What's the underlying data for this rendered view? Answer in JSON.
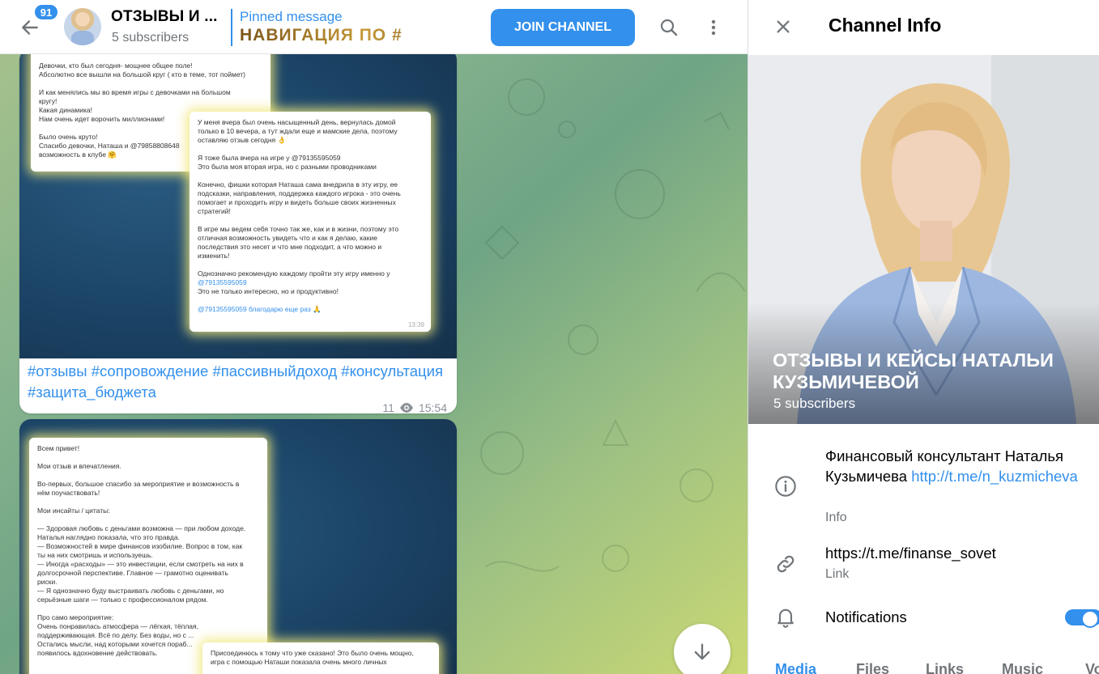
{
  "header": {
    "unread_count": "91",
    "channel_title": "ОТЗЫВЫ И ...",
    "subscribers": "5 subscribers",
    "pinned_label": "Pinned message",
    "pinned_text": "НАВИГАЦИЯ ПО #",
    "join_label": "JOIN CHANNEL",
    "icons": [
      "back-arrow-icon",
      "search-icon",
      "more-vertical-icon"
    ]
  },
  "messages": [
    {
      "caption": "#отзывы #сопровождение #пассивныйдоход #консультация #защита_бюджета",
      "views": "11",
      "time": "15:54",
      "card1_lines": [
        "Девочки, кто был сегодня- мощнее общее поле!",
        "Абсолютно все вышли на большой круг ( кто в теме, тот поймет)",
        "",
        "И как менялись мы во время игры с девочками на большом",
        "кругу!",
        "Какая динамика!",
        "Нам очень идет ворочить миллионами!",
        "",
        "Было очень круто!",
        "Спасибо девочки, Наташа и @79858808648",
        "возможность в клубе 🤗"
      ],
      "card2_lines": [
        "У меня вчера был очень насыщенный день, вернулась домой",
        "только в 10 вечера, а тут ждали еще и мамские дела, поэтому",
        "оставляю отзыв сегодня 👌",
        "",
        "Я тоже была вчера на игре у @79135595059",
        "Это была моя вторая игра, но с разными проводниками",
        "",
        "Конечно, фишки которая Наташа сама внедрила в эту игру, ее",
        "подсказки, направления, поддержка каждого игрока - это очень",
        "помогает и проходить игру и видеть больше своих жизненных",
        "стратегий!",
        "",
        "В игре мы ведем себя точно так же, как и в жизни, поэтому это",
        "отличная возможность увидеть что и как я делаю, какие",
        "последствия это несет и что мне подходит, а что можно и",
        "изменить!",
        "",
        "Однозначно рекомендую каждому пройти эту игру именно у",
        "@79135595059",
        "Это не только интересно, но и продуктивно!",
        "",
        "@79135595059 благодарю еще раз 🙏"
      ],
      "card2_time": "13:39"
    },
    {
      "card1_lines": [
        "Всем привет!",
        "",
        "Мои отзыв и впечатления.",
        "",
        "Во-первых, большое спасибо за мероприятие и возможность в",
        "нём поучаствовать!",
        "",
        "Мои инсайты / цитаты:",
        "",
        "— Здоровая любовь с деньгами возможна — при любом доходе.",
        "Наталья наглядно показала, что это правда.",
        "— Возможностей в мире финансов изобилие. Вопрос в том, как",
        "ты на них смотришь и используешь.",
        "— Иногда «расходы» — это инвестиции, если смотреть на них в",
        "долгосрочной перспективе. Главное — грамотно оценивать",
        "риски.",
        "— Я однозначно буду выстраивать любовь с деньгами, но",
        "серьёзные шаги — только с профессионалом рядом.",
        "",
        "Про само мероприятие:",
        "Очень понравилась атмосфера — лёгкая, тёплая,",
        "поддерживающая. Всё по делу. Без воды, но с ...",
        "Остались мысли, над которыми хочется пораб...",
        "появилось вдохновение действовать."
      ],
      "card2_lines": [
        "Присоединюсь к тому что уже сказано! Это было очень мощно,",
        "игра с помощью Наташи показала очень много личных"
      ]
    }
  ],
  "info": {
    "title": "Channel Info",
    "channel_name": "ОТЗЫВЫ И КЕЙСЫ НАТАЛЬИ КУЗЬМИЧЕВОЙ",
    "subscribers": "5 subscribers",
    "description": "Финансовый консультант Наталья Кузьмичева",
    "description_link": "http://t.me/n_kuzmicheva",
    "description_label": "Info",
    "link": "https://t.me/finanse_sovet",
    "link_label": "Link",
    "notifications_label": "Notifications",
    "notifications_on": true,
    "tabs": [
      "Media",
      "Files",
      "Links",
      "Music",
      "Vo"
    ],
    "active_tab": "Media"
  },
  "colors": {
    "accent": "#3390ec",
    "muted": "#707579"
  }
}
